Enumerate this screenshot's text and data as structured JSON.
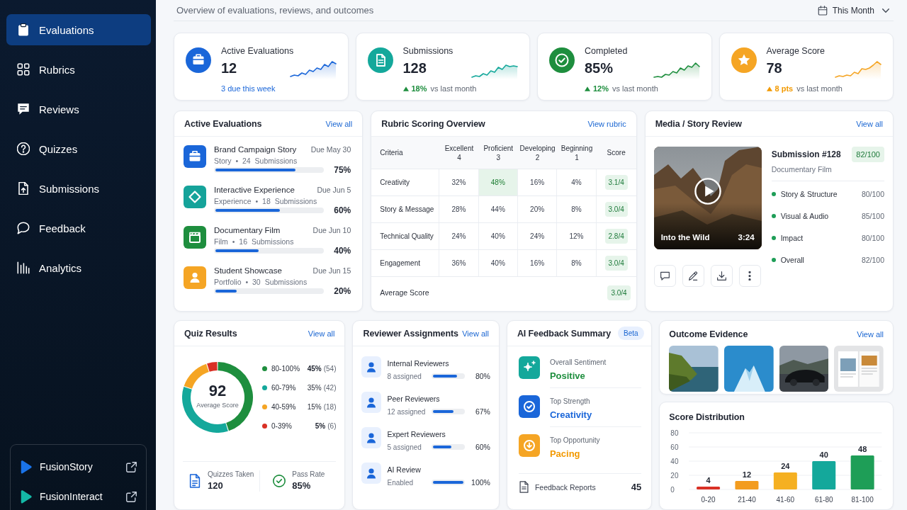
{
  "header": {
    "subtitle": "Overview of evaluations, reviews, and outcomes",
    "period": "This Month"
  },
  "sidebar": {
    "items": [
      {
        "label": "Evaluations",
        "selected": true
      },
      {
        "label": "Rubrics",
        "selected": false
      },
      {
        "label": "Reviews",
        "selected": false
      },
      {
        "label": "Quizzes",
        "selected": false
      },
      {
        "label": "Submissions",
        "selected": false
      },
      {
        "label": "Feedback",
        "selected": false
      },
      {
        "label": "Analytics",
        "selected": false
      }
    ],
    "apps": [
      {
        "label": "FusionStory",
        "color": "#1a73e8"
      },
      {
        "label": "FusionInteract",
        "color": "#14b8a6"
      }
    ]
  },
  "stats": [
    {
      "title": "Active Evaluations",
      "value": "12",
      "color": "#1a66d9",
      "kind": "note",
      "note": "3 due this week"
    },
    {
      "title": "Submissions",
      "value": "128",
      "color": "#14a89b",
      "kind": "trend",
      "change": {
        "text": "18%",
        "color": "#1e8e3e"
      },
      "comparison": "vs last month"
    },
    {
      "title": "Completed",
      "value": "85%",
      "color": "#1e8e3e",
      "kind": "trend",
      "change": {
        "text": "12%",
        "color": "#1e8e3e"
      },
      "comparison": "vs last month"
    },
    {
      "title": "Average Score",
      "value": "78",
      "color": "#f5a524",
      "kind": "trend",
      "change": {
        "text": "8 pts",
        "color": "#f29900"
      },
      "comparison": "vs last month"
    }
  ],
  "active_evaluations": {
    "title": "Active Evaluations",
    "link": "View all",
    "items": [
      {
        "title": "Brand Campaign Story",
        "due": "Due May 30",
        "meta": "Story • 24 Submissions",
        "level": 0.75,
        "percent": "75%",
        "color": "#1a66d9"
      },
      {
        "title": "Interactive Experience",
        "due": "Due Jun 5",
        "meta": "Experience • 18 Submissions",
        "level": 0.6,
        "percent": "60%",
        "color": "#15a39a"
      },
      {
        "title": "Documentary Film",
        "due": "Due Jun 10",
        "meta": "Film • 16 Submissions",
        "level": 0.4,
        "percent": "40%",
        "color": "#1e8e3e"
      },
      {
        "title": "Student Showcase",
        "due": "Due Jun 15",
        "meta": "Portfolio • 30 Submissions",
        "level": 0.2,
        "percent": "20%",
        "color": "#f5a524"
      }
    ]
  },
  "rubric": {
    "title": "Rubric Scoring Overview",
    "link": "View rubric",
    "columns": [
      {
        "label": "Criteria"
      },
      {
        "label": "Excellent",
        "points": "4"
      },
      {
        "label": "Proficient",
        "points": "3"
      },
      {
        "label": "Developing",
        "points": "2"
      },
      {
        "label": "Beginning",
        "points": "1"
      },
      {
        "label": "Score"
      }
    ],
    "rows": [
      {
        "cells": [
          {
            "kind": "label",
            "text": "Creativity",
            "highlighted": false
          },
          {
            "kind": "value",
            "text": "32%",
            "highlighted": false
          },
          {
            "kind": "value",
            "text": "48%",
            "highlighted": true
          },
          {
            "kind": "value",
            "text": "16%",
            "highlighted": false
          },
          {
            "kind": "value",
            "text": "4%",
            "highlighted": false
          },
          {
            "kind": "score",
            "text": "3.1/4",
            "highlighted": false
          }
        ]
      },
      {
        "cells": [
          {
            "kind": "label",
            "text": "Story & Message",
            "highlighted": false
          },
          {
            "kind": "value",
            "text": "28%",
            "highlighted": false
          },
          {
            "kind": "value",
            "text": "44%",
            "highlighted": false
          },
          {
            "kind": "value",
            "text": "20%",
            "highlighted": false
          },
          {
            "kind": "value",
            "text": "8%",
            "highlighted": false
          },
          {
            "kind": "score",
            "text": "3.0/4",
            "highlighted": false
          }
        ]
      },
      {
        "cells": [
          {
            "kind": "label",
            "text": "Technical Quality",
            "highlighted": false
          },
          {
            "kind": "value",
            "text": "24%",
            "highlighted": false
          },
          {
            "kind": "value",
            "text": "40%",
            "highlighted": false
          },
          {
            "kind": "value",
            "text": "24%",
            "highlighted": false
          },
          {
            "kind": "value",
            "text": "12%",
            "highlighted": false
          },
          {
            "kind": "score",
            "text": "2.8/4",
            "highlighted": false
          }
        ]
      },
      {
        "cells": [
          {
            "kind": "label",
            "text": "Engagement",
            "highlighted": false
          },
          {
            "kind": "value",
            "text": "36%",
            "highlighted": false
          },
          {
            "kind": "value",
            "text": "40%",
            "highlighted": false
          },
          {
            "kind": "value",
            "text": "16%",
            "highlighted": false
          },
          {
            "kind": "value",
            "text": "8%",
            "highlighted": false
          },
          {
            "kind": "score",
            "text": "3.0/4",
            "highlighted": false
          }
        ]
      }
    ],
    "average": {
      "label": "Average Score",
      "score": "3.0/4"
    }
  },
  "media_review": {
    "title": "Media / Story Review",
    "link": "View all",
    "video": {
      "title": "Into the Wild",
      "duration": "3:24"
    },
    "submission": "Submission #128",
    "score": "82/100",
    "category": "Documentary Film",
    "criteria": [
      {
        "label": "Story & Structure",
        "score": "80/100"
      },
      {
        "label": "Visual & Audio",
        "score": "85/100"
      },
      {
        "label": "Impact",
        "score": "80/100"
      },
      {
        "label": "Overall",
        "score": "82/100"
      }
    ]
  },
  "quiz": {
    "title": "Quiz Results",
    "link": "View all",
    "average": "92",
    "average_label": "Average Score",
    "chart_data": {
      "type": "donut",
      "categories": [
        "80-100%",
        "60-79%",
        "40-59%",
        "0-39%"
      ],
      "values": [
        45,
        35,
        15,
        5
      ],
      "colors": [
        "#1e8e3e",
        "#14a89b",
        "#f5a524",
        "#d93025"
      ]
    },
    "legend": [
      {
        "share": "45%",
        "count": "(54)",
        "emphasized": true
      },
      {
        "share": "35%",
        "count": "(42)",
        "emphasized": false
      },
      {
        "share": "15%",
        "count": "(18)",
        "emphasized": false
      },
      {
        "share": "5%",
        "count": "(6)",
        "emphasized": true
      }
    ],
    "stats": [
      {
        "label": "Quizzes Taken",
        "value": "120"
      },
      {
        "label": "Pass Rate",
        "value": "85%"
      }
    ]
  },
  "reviewers": {
    "title": "Reviewer Assignments",
    "link": "View all",
    "items": [
      {
        "name": "Internal Reviewers",
        "detail": "8 assigned",
        "level": 0.8,
        "percent": "80%"
      },
      {
        "name": "Peer Reviewers",
        "detail": "12 assigned",
        "level": 0.67,
        "percent": "67%"
      },
      {
        "name": "Expert Reviewers",
        "detail": "5 assigned",
        "level": 0.6,
        "percent": "60%"
      },
      {
        "name": "AI Review",
        "detail": "Enabled",
        "level": 1,
        "percent": "100%"
      }
    ]
  },
  "ai_feedback": {
    "title": "AI Feedback Summary",
    "badge": "Beta",
    "items": [
      {
        "label": "Overall Sentiment",
        "value": {
          "text": "Positive",
          "color": "#1e8e3e"
        },
        "color": "#14a89b"
      },
      {
        "label": "Top Strength",
        "value": {
          "text": "Creativity",
          "color": "#1a66d9"
        },
        "color": "#1a66d9"
      },
      {
        "label": "Top Opportunity",
        "value": {
          "text": "Pacing",
          "color": "#f29900"
        },
        "color": "#f5a524"
      }
    ],
    "reports": {
      "label": "Feedback Reports",
      "value": "45"
    }
  },
  "outcome_evidence": {
    "title": "Outcome Evidence",
    "link": "View all",
    "photos": [
      {
        "kind": "landscape"
      },
      {
        "kind": "poster"
      },
      {
        "kind": "car"
      },
      {
        "kind": "document"
      }
    ]
  },
  "score_distribution": {
    "title": "Score Distribution",
    "chart_data": {
      "type": "bar",
      "categories": [
        "0-20",
        "21-40",
        "41-60",
        "61-80",
        "81-100"
      ],
      "values": [
        4,
        12,
        24,
        40,
        48
      ],
      "colors": [
        "#d93025",
        "#f39c1f",
        "#f5b021",
        "#14a89b",
        "#1e9e57"
      ],
      "ylim": [
        0,
        80
      ],
      "yticks": [
        0,
        20,
        40,
        60,
        80
      ],
      "grid": true,
      "data_labels": true
    }
  }
}
